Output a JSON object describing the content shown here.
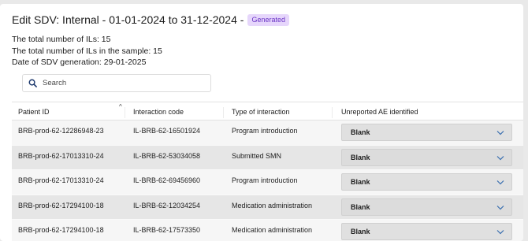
{
  "header": {
    "title": "Edit SDV: Internal - 01-01-2024 to 31-12-2024 -",
    "badge": "Generated"
  },
  "info": {
    "total_ils": "The total number of ILs: 15",
    "total_sample": "The total number of ILs in the sample: 15",
    "date_generated": "Date of SDV generation: 29-01-2025"
  },
  "search": {
    "placeholder": "Search",
    "icon": "search-icon"
  },
  "table": {
    "columns": [
      "Patient ID",
      "Interaction code",
      "Type of interaction",
      "Unreported AE identified"
    ],
    "sort_icon": "sort-up-icon",
    "rows": [
      {
        "patient_id": "BRB-prod-62-12286948-23",
        "code": "IL-BRB-62-16501924",
        "type": "Program introduction",
        "ae": "Blank"
      },
      {
        "patient_id": "BRB-prod-62-17013310-24",
        "code": "IL-BRB-62-53034058",
        "type": "Submitted SMN",
        "ae": "Blank"
      },
      {
        "patient_id": "BRB-prod-62-17013310-24",
        "code": "IL-BRB-62-69456960",
        "type": "Program introduction",
        "ae": "Blank"
      },
      {
        "patient_id": "BRB-prod-62-17294100-18",
        "code": "IL-BRB-62-12034254",
        "type": "Medication administration",
        "ae": "Blank"
      },
      {
        "patient_id": "BRB-prod-62-17294100-18",
        "code": "IL-BRB-62-17573350",
        "type": "Medication administration",
        "ae": "Blank"
      }
    ]
  },
  "colors": {
    "badge_bg": "#e6d6fb",
    "badge_text": "#6b36c6",
    "row_odd": "#f6f6f6",
    "row_even": "#e6e6e6"
  }
}
